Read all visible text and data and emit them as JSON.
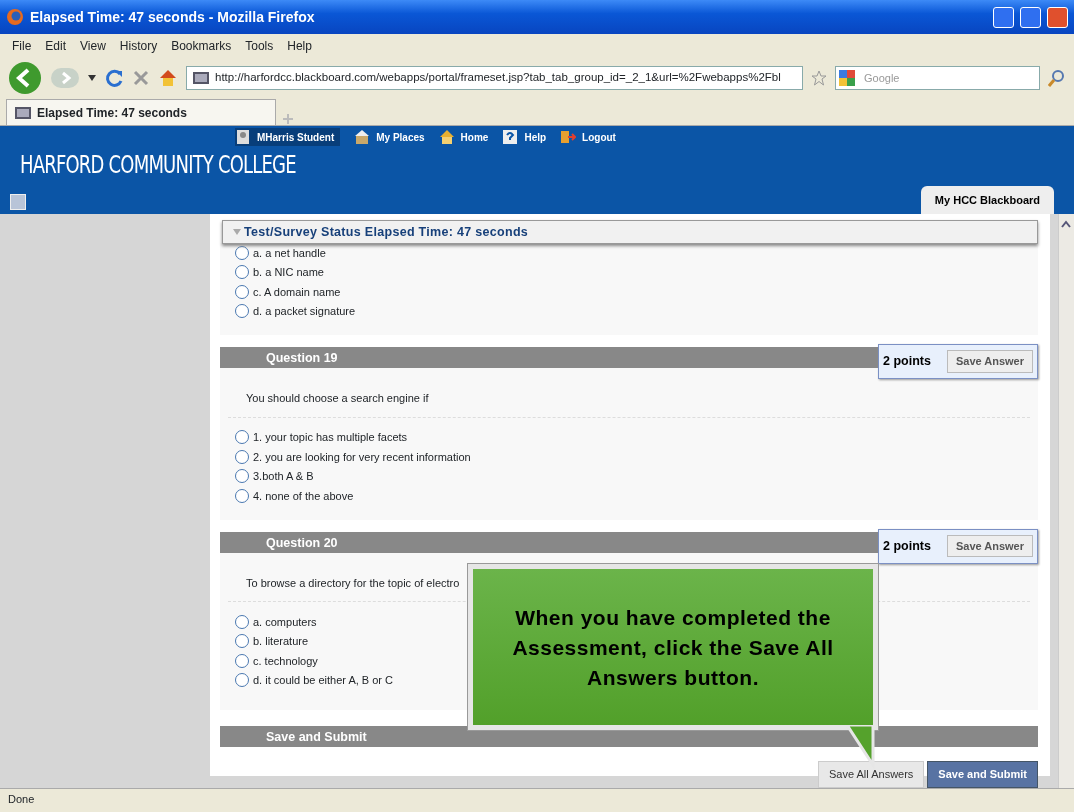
{
  "window": {
    "title": "Elapsed Time: 47 seconds - Mozilla Firefox"
  },
  "menu": [
    "File",
    "Edit",
    "View",
    "History",
    "Bookmarks",
    "Tools",
    "Help"
  ],
  "toolbar": {
    "url": "http://harfordcc.blackboard.com/webapps/portal/frameset.jsp?tab_tab_group_id=_2_1&url=%2Fwebapps%2Fbl",
    "search_placeholder": "Google"
  },
  "tabs": [
    {
      "label": "Elapsed Time: 47 seconds",
      "selected": true
    }
  ],
  "banner": {
    "title": "HARFORD COMMUNITY COLLEGE",
    "links": [
      {
        "label": "MHarris Student",
        "kind": "user",
        "selected": true
      },
      {
        "label": "My Places",
        "kind": "places",
        "selected": false
      },
      {
        "label": "Home",
        "kind": "home",
        "selected": false
      },
      {
        "label": "Help",
        "kind": "help",
        "selected": false
      },
      {
        "label": "Logout",
        "kind": "logout",
        "selected": false
      }
    ],
    "course_tab": "My HCC Blackboard"
  },
  "status_panel": "Test/Survey Status Elapsed Time: 47 seconds",
  "questions": [
    {
      "options": [
        {
          "label": "a. a net handle",
          "selected": false
        },
        {
          "label": "b. a NIC name",
          "selected": false
        },
        {
          "label": "c. A domain name",
          "selected": false
        },
        {
          "label": "d. a packet signature",
          "selected": false
        }
      ]
    },
    {
      "title": "Question 19",
      "points": "2 points",
      "button": "Save Answer",
      "prompt": "You should choose a search engine if",
      "options": [
        {
          "label": "1. your topic has multiple facets",
          "selected": false
        },
        {
          "label": "2. you are looking for very recent information",
          "selected": false
        },
        {
          "label": "3.both A & B",
          "selected": false
        },
        {
          "label": "4. none of the above",
          "selected": false
        }
      ]
    },
    {
      "title": "Question 20",
      "points": "2 points",
      "button": "Save Answer",
      "prompt": "To browse a directory for the topic of electro",
      "options": [
        {
          "label": "a. computers",
          "selected": false
        },
        {
          "label": "b. literature",
          "selected": false
        },
        {
          "label": "c. technology",
          "selected": false
        },
        {
          "label": "d. it could be either A, B or C",
          "selected": false
        }
      ]
    }
  ],
  "submit_section": "Save and Submit",
  "buttons": [
    {
      "label": "Save All Answers",
      "kind": "secondary"
    },
    {
      "label": "Save and Submit",
      "kind": "primary"
    }
  ],
  "callout": "When you have completed the Assessment, click the Save All Answers button.",
  "status_bar": "Done"
}
